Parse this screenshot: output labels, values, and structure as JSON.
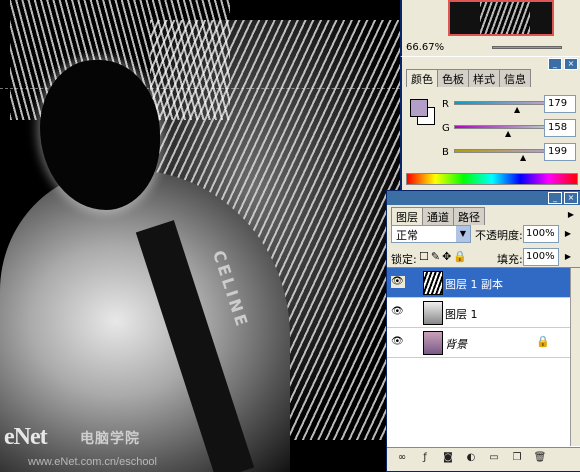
{
  "navigator": {
    "zoom": "66.67%"
  },
  "color_panel": {
    "tabs": [
      {
        "label": "颜色"
      },
      {
        "label": "色板"
      },
      {
        "label": "样式"
      },
      {
        "label": "信息"
      }
    ],
    "foreground_color": "#b39ec7",
    "background_color": "#ffffff",
    "channels": [
      {
        "label": "R",
        "value": "179"
      },
      {
        "label": "G",
        "value": "158"
      },
      {
        "label": "B",
        "value": "199"
      }
    ]
  },
  "layers_panel": {
    "tabs": [
      {
        "label": "图层"
      },
      {
        "label": "通道"
      },
      {
        "label": "路径"
      }
    ],
    "blend_mode": "正常",
    "opacity_label": "不透明度:",
    "opacity_value": "100%",
    "lock_label": "锁定:",
    "fill_label": "填充:",
    "fill_value": "100%",
    "layers": [
      {
        "name": "图层 1 副本",
        "selected": true
      },
      {
        "name": "图层 1",
        "selected": false
      },
      {
        "name": "背景",
        "selected": false,
        "locked": true
      }
    ]
  },
  "canvas": {
    "strap_text": "CELINE",
    "watermark": "eNet",
    "watermark_dot": ".com.cn",
    "watermark_cn": "电脑学院",
    "watermark_url": "www.eNet.com.cn/eschool"
  }
}
